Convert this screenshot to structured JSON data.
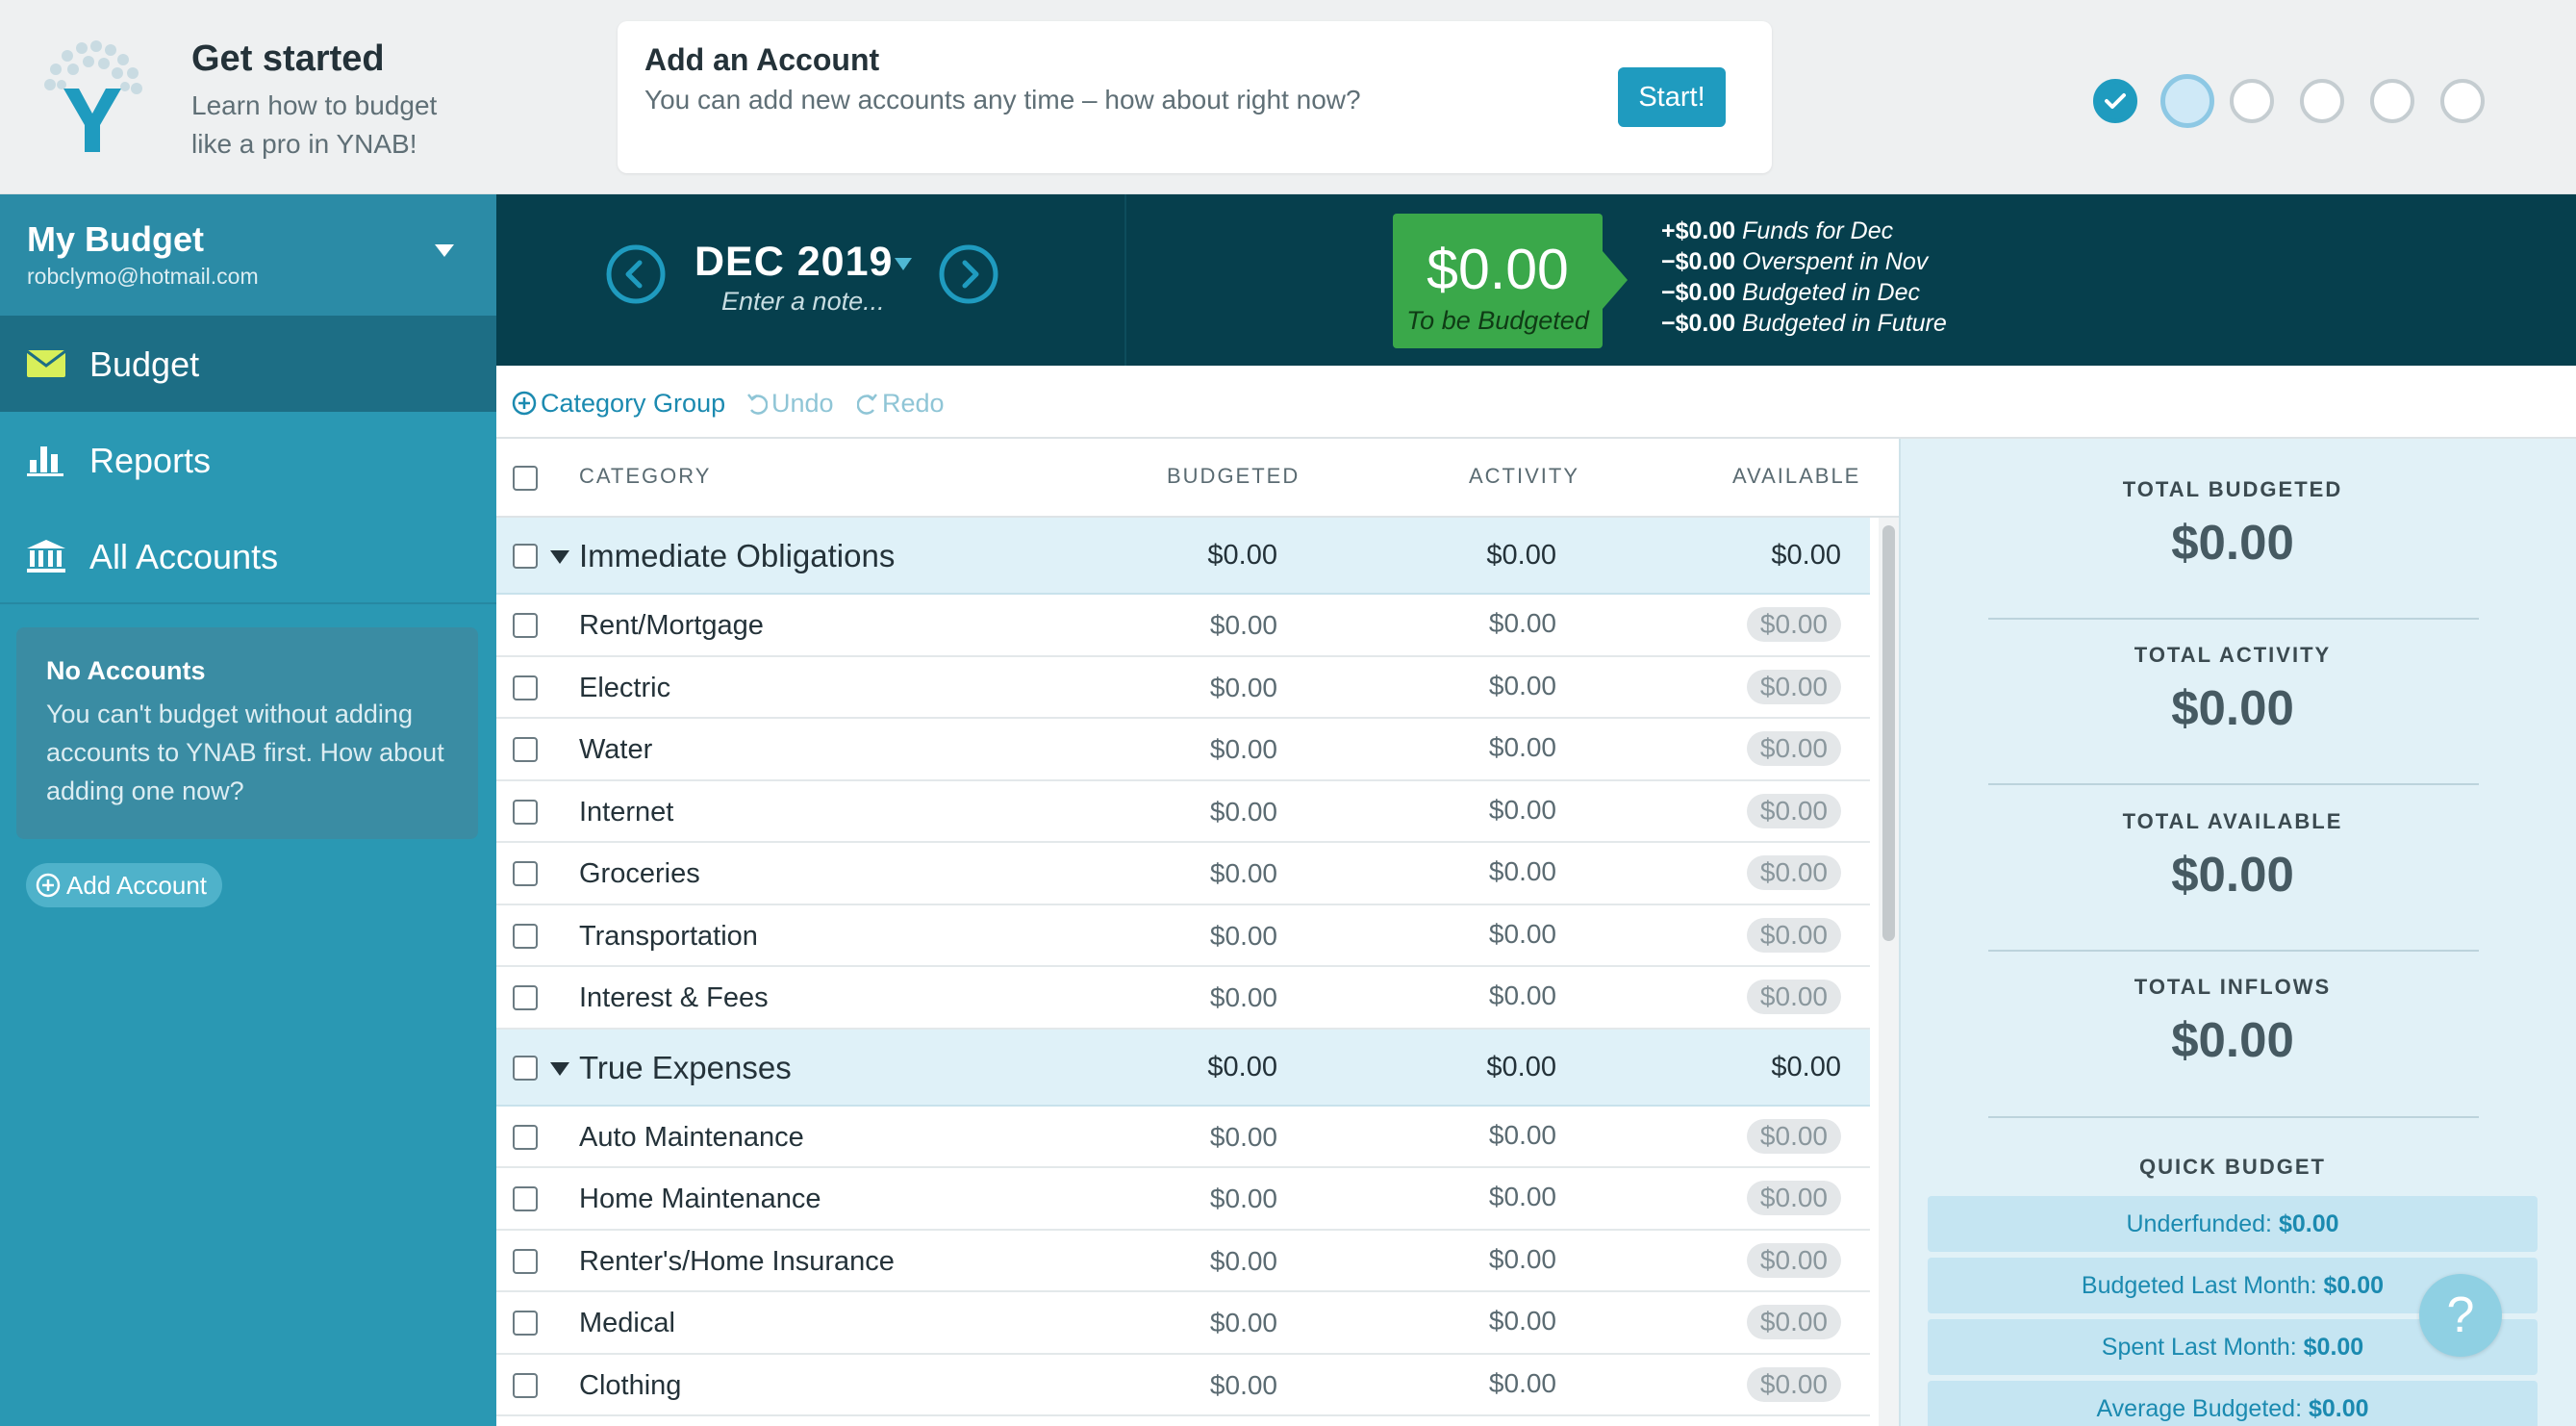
{
  "onboarding": {
    "title": "Get started",
    "subtitle": "Learn how to budget like a pro in YNAB!",
    "promo_title": "Add an Account",
    "promo_text": "You can add new accounts any time – how about right now?",
    "promo_button": "Start!",
    "steps_total": 6,
    "steps_completed": 1,
    "current_step": 2
  },
  "sidebar": {
    "budget_name": "My Budget",
    "email": "robclymo@hotmail.com",
    "nav": [
      {
        "label": "Budget",
        "icon": "envelope-icon",
        "active": true
      },
      {
        "label": "Reports",
        "icon": "bar-chart-icon",
        "active": false
      },
      {
        "label": "All Accounts",
        "icon": "bank-icon",
        "active": false
      }
    ],
    "no_accounts_title": "No Accounts",
    "no_accounts_text": "You can't budget without adding accounts to YNAB first. How about adding one now?",
    "add_account_label": "Add Account"
  },
  "month": {
    "label": "DEC 2019",
    "note_placeholder": "Enter a note...",
    "to_be_budgeted_amount": "$0.00",
    "to_be_budgeted_label": "To be Budgeted",
    "breakdown": [
      {
        "amount": "+$0.00",
        "label": "Funds for Dec"
      },
      {
        "amount": "−$0.00",
        "label": "Overspent in Nov"
      },
      {
        "amount": "−$0.00",
        "label": "Budgeted in Dec"
      },
      {
        "amount": "−$0.00",
        "label": "Budgeted in Future"
      }
    ]
  },
  "toolbar": {
    "category_group": "Category Group",
    "undo": "Undo",
    "redo": "Redo"
  },
  "table": {
    "columns": [
      "CATEGORY",
      "BUDGETED",
      "ACTIVITY",
      "AVAILABLE"
    ],
    "rows": [
      {
        "type": "group",
        "name": "Immediate Obligations",
        "budgeted": "$0.00",
        "activity": "$0.00",
        "available": "$0.00"
      },
      {
        "type": "category",
        "name": "Rent/Mortgage",
        "budgeted": "$0.00",
        "activity": "$0.00",
        "available": "$0.00"
      },
      {
        "type": "category",
        "name": "Electric",
        "budgeted": "$0.00",
        "activity": "$0.00",
        "available": "$0.00"
      },
      {
        "type": "category",
        "name": "Water",
        "budgeted": "$0.00",
        "activity": "$0.00",
        "available": "$0.00"
      },
      {
        "type": "category",
        "name": "Internet",
        "budgeted": "$0.00",
        "activity": "$0.00",
        "available": "$0.00"
      },
      {
        "type": "category",
        "name": "Groceries",
        "budgeted": "$0.00",
        "activity": "$0.00",
        "available": "$0.00"
      },
      {
        "type": "category",
        "name": "Transportation",
        "budgeted": "$0.00",
        "activity": "$0.00",
        "available": "$0.00"
      },
      {
        "type": "category",
        "name": "Interest & Fees",
        "budgeted": "$0.00",
        "activity": "$0.00",
        "available": "$0.00"
      },
      {
        "type": "group",
        "name": "True Expenses",
        "budgeted": "$0.00",
        "activity": "$0.00",
        "available": "$0.00"
      },
      {
        "type": "category",
        "name": "Auto Maintenance",
        "budgeted": "$0.00",
        "activity": "$0.00",
        "available": "$0.00"
      },
      {
        "type": "category",
        "name": "Home Maintenance",
        "budgeted": "$0.00",
        "activity": "$0.00",
        "available": "$0.00"
      },
      {
        "type": "category",
        "name": "Renter's/Home Insurance",
        "budgeted": "$0.00",
        "activity": "$0.00",
        "available": "$0.00"
      },
      {
        "type": "category",
        "name": "Medical",
        "budgeted": "$0.00",
        "activity": "$0.00",
        "available": "$0.00"
      },
      {
        "type": "category",
        "name": "Clothing",
        "budgeted": "$0.00",
        "activity": "$0.00",
        "available": "$0.00"
      }
    ]
  },
  "inspector": {
    "stats": [
      {
        "label": "TOTAL BUDGETED",
        "value": "$0.00"
      },
      {
        "label": "TOTAL ACTIVITY",
        "value": "$0.00"
      },
      {
        "label": "TOTAL AVAILABLE",
        "value": "$0.00"
      },
      {
        "label": "TOTAL INFLOWS",
        "value": "$0.00"
      }
    ],
    "quick_budget_title": "QUICK BUDGET",
    "quick_budget": [
      {
        "label": "Underfunded:",
        "value": "$0.00"
      },
      {
        "label": "Budgeted Last Month:",
        "value": "$0.00"
      },
      {
        "label": "Spent Last Month:",
        "value": "$0.00"
      },
      {
        "label": "Average Budgeted:",
        "value": "$0.00"
      }
    ],
    "help_label": "?"
  },
  "colors": {
    "brand": "#1f9bbf",
    "sidebar": "#2a98b3",
    "month_header": "#063f4d",
    "to_be_budgeted": "#3aa84a"
  }
}
